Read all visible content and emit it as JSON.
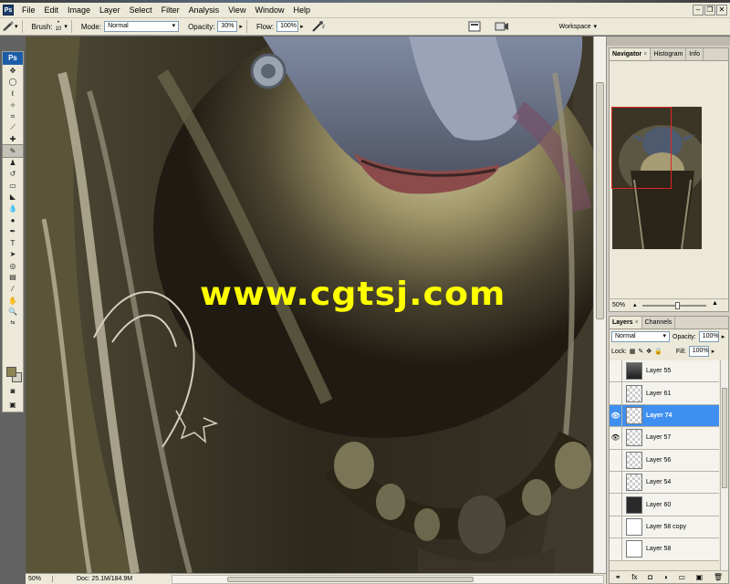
{
  "menubar": {
    "items": [
      "File",
      "Edit",
      "Image",
      "Layer",
      "Select",
      "Filter",
      "Analysis",
      "View",
      "Window",
      "Help"
    ]
  },
  "options": {
    "brush_label": "Brush:",
    "brush_size": "10",
    "mode_label": "Mode:",
    "mode_value": "Normal",
    "opacity_label": "Opacity:",
    "opacity_value": "30%",
    "flow_label": "Flow:",
    "flow_value": "100%",
    "workspace_label": "Workspace"
  },
  "toolbox": {
    "logo": "Ps"
  },
  "canvas": {
    "watermark": "www.cgtsj.com"
  },
  "status": {
    "zoom": "50%",
    "doc": "Doc: 25.1M/184.9M"
  },
  "navigator": {
    "tabs": [
      "Navigator",
      "Histogram",
      "Info"
    ],
    "zoom": "50%"
  },
  "layers_panel": {
    "tabs": [
      "Layers",
      "Channels"
    ],
    "blend_mode": "Normal",
    "opacity_label": "Opacity:",
    "opacity_value": "100%",
    "lock_label": "Lock:",
    "fill_label": "Fill:",
    "fill_value": "100%",
    "layers": [
      {
        "name": "Layer 55",
        "visible": false,
        "thumb": "art"
      },
      {
        "name": "Layer 61",
        "visible": false,
        "thumb": "checker"
      },
      {
        "name": "Layer 74",
        "visible": true,
        "thumb": "checker",
        "selected": true
      },
      {
        "name": "Layer 57",
        "visible": true,
        "thumb": "checker"
      },
      {
        "name": "Layer 56",
        "visible": false,
        "thumb": "checker"
      },
      {
        "name": "Layer 54",
        "visible": false,
        "thumb": "checker"
      },
      {
        "name": "Layer 60",
        "visible": false,
        "thumb": "dark"
      },
      {
        "name": "Layer 58 copy",
        "visible": false,
        "thumb": "white"
      },
      {
        "name": "Layer 58",
        "visible": false,
        "thumb": "white"
      }
    ]
  },
  "colors": {
    "foreground": "#8d8456",
    "background": "#d7d2c4",
    "selection": "#3f8ff0",
    "watermark": "#ffff00",
    "navigator_frame": "#e02525"
  }
}
